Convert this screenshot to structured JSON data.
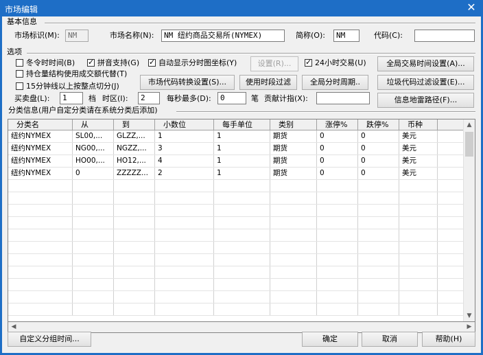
{
  "window": {
    "title": "市场编辑",
    "close_glyph": "✕"
  },
  "basic": {
    "section": "基本信息",
    "market_id_label": "市场标识(M):",
    "market_id_value": "NM",
    "market_name_label": "市场名称(N):",
    "market_name_value": "NM 纽约商品交易所(NYMEX)",
    "short_label": "简称(O):",
    "short_value": "NM",
    "code_label": "代码(C):",
    "code_value": ""
  },
  "options": {
    "section": "选项",
    "winter_time": {
      "label": "冬令时时间(B)",
      "checked": false
    },
    "pinyin": {
      "label": "拼音支持(G)",
      "checked": true
    },
    "auto_coord": {
      "label": "自动显示分时图坐标(Y)",
      "checked": true
    },
    "settings_button": "设置(R)...",
    "trade24": {
      "label": "24小时交易(U)",
      "checked": true
    },
    "global_time_button": "全局交易时间设置(A)...",
    "position_struct": {
      "label": "持仓量结构使用成交额代替(T)",
      "checked": false
    },
    "min15": {
      "label": "15分钟线以上按整点切分(J)",
      "checked": false
    },
    "code_convert_button": "市场代码转换设置(S)...",
    "time_filter_button": "使用时段过滤",
    "global_period_button": "全局分时周期..",
    "junk_filter_button": "垃圾代码过滤设置(E)...",
    "depth_label": "买卖盘(L):",
    "depth_value": "1",
    "depth_unit": "档",
    "timezone_label": "时区(I):",
    "timezone_value": "2",
    "per_sec_label": "每秒最多(D):",
    "per_sec_value": "0",
    "per_sec_unit": "笔",
    "contrib_label": "贡献计指(X):",
    "contrib_value": "",
    "info_path_button": "信息地雷路径(F)..."
  },
  "categories": {
    "section": "分类信息(用户自定分类请在系统分类后添加)",
    "columns": [
      "分类名",
      "从",
      "到",
      "小数位",
      "每手单位",
      "类别",
      "涨停%",
      "跌停%",
      "币种"
    ],
    "rows": [
      [
        "纽约NYMEX",
        "SL00,...",
        "GLZZ,...",
        "1",
        "1",
        "期货",
        "0",
        "0",
        "美元"
      ],
      [
        "纽约NYMEX",
        "NG00,...",
        "NGZZ,...",
        "3",
        "1",
        "期货",
        "0",
        "0",
        "美元"
      ],
      [
        "纽约NYMEX",
        "HO00,...",
        "HO12,...",
        "4",
        "1",
        "期货",
        "0",
        "0",
        "美元"
      ],
      [
        "纽约NYMEX",
        "0",
        "ZZZZZ...",
        "2",
        "1",
        "期货",
        "0",
        "0",
        "美元"
      ]
    ]
  },
  "footer": {
    "custom_group_button": "自定义分组时间...",
    "ok_button": "确定",
    "cancel_button": "取消",
    "help_button": "帮助(H)"
  }
}
